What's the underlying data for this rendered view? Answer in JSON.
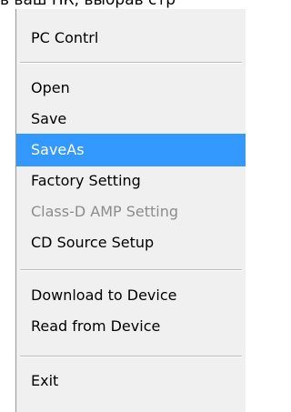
{
  "background": {
    "partial_text": "в ваш ПК, выбрав стр"
  },
  "menu": {
    "items": [
      {
        "label": "PC Contrl",
        "state": "normal"
      },
      {
        "label": "Open",
        "state": "normal"
      },
      {
        "label": "Save",
        "state": "normal"
      },
      {
        "label": "SaveAs",
        "state": "selected"
      },
      {
        "label": "Factory Setting",
        "state": "normal"
      },
      {
        "label": "Class-D AMP Setting",
        "state": "disabled"
      },
      {
        "label": "CD Source Setup",
        "state": "normal"
      },
      {
        "label": "Download to Device",
        "state": "normal"
      },
      {
        "label": "Read from Device",
        "state": "normal"
      },
      {
        "label": "Exit",
        "state": "normal"
      }
    ]
  },
  "colors": {
    "selection": "#3399ff",
    "menu_background": "#f0f0f0",
    "disabled_text": "#8c8c8c"
  }
}
